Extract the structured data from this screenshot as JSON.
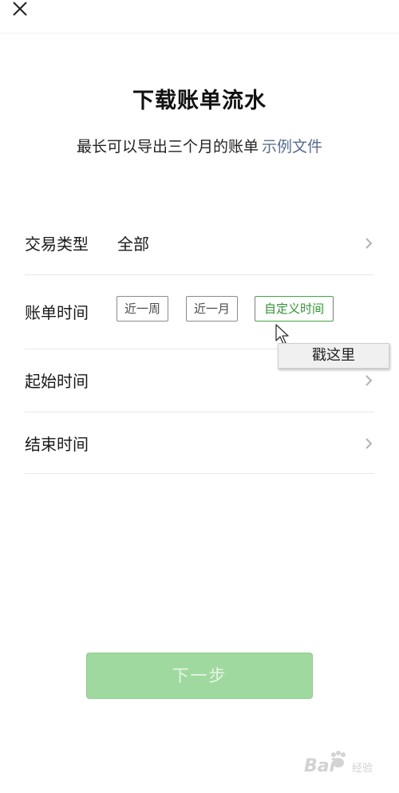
{
  "header": {
    "close_icon": "close-icon"
  },
  "page": {
    "title": "下载账单流水",
    "subtitle": "最长可以导出三个月的账单",
    "example_link": "示例文件"
  },
  "form": {
    "type_row": {
      "label": "交易类型",
      "value": "全部"
    },
    "time_row": {
      "label": "账单时间",
      "options": [
        "近一周",
        "近一月",
        "自定义时间"
      ],
      "selected": "自定义时间"
    },
    "start_row": {
      "label": "起始时间"
    },
    "end_row": {
      "label": "结束时间"
    }
  },
  "tooltip": {
    "text": "戳这里"
  },
  "footer": {
    "next_label": "下一步"
  },
  "watermark": {
    "logo": "Bai",
    "text": "经验"
  },
  "colors": {
    "accent_green": "#2c9a2c",
    "button_green": "#a0d9a0",
    "link_blue": "#576b95"
  }
}
